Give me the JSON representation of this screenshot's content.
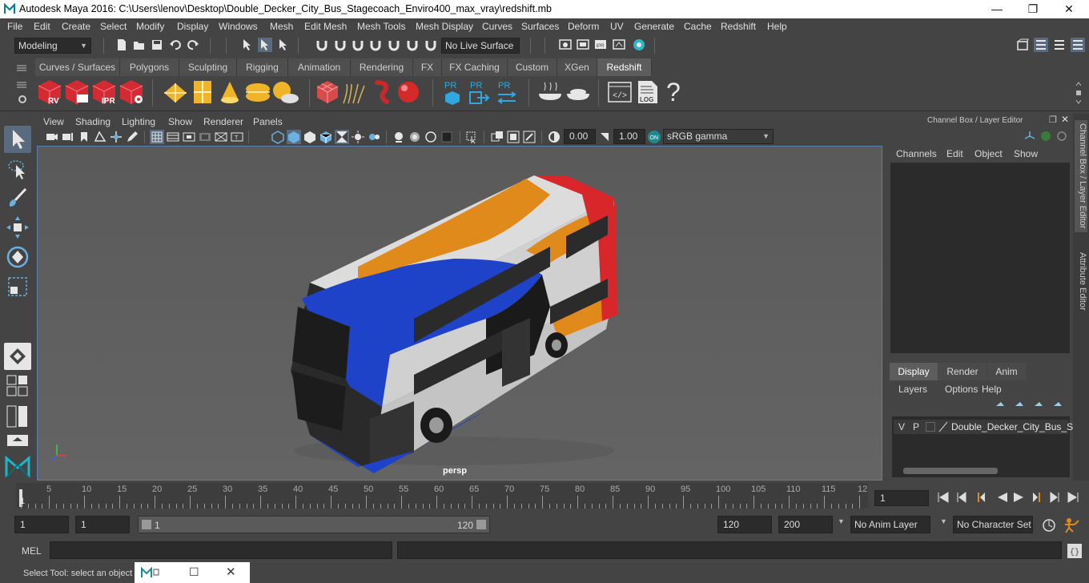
{
  "window": {
    "title": "Autodesk Maya 2016: C:\\Users\\lenov\\Desktop\\Double_Decker_City_Bus_Stagecoach_Enviro400_max_vray\\redshift.mb",
    "minimize": "—",
    "maximize": "❐",
    "close": "✕"
  },
  "menubar": [
    "File",
    "Edit",
    "Create",
    "Select",
    "Modify",
    "Display",
    "Windows",
    "Mesh",
    "Edit Mesh",
    "Mesh Tools",
    "Mesh Display",
    "Curves",
    "Surfaces",
    "Deform",
    "UV",
    "Generate",
    "Cache",
    "Redshift",
    "Help"
  ],
  "statusline": {
    "mode": "Modeling",
    "live_surface": "No Live Surface"
  },
  "shelf_tabs": [
    "Curves / Surfaces",
    "Polygons",
    "Sculpting",
    "Rigging",
    "Animation",
    "Rendering",
    "FX",
    "FX Caching",
    "Custom",
    "XGen",
    "Redshift"
  ],
  "active_shelf_tab": "Redshift",
  "shelf_icons": {
    "rv": "RV",
    "ipr": "IPR",
    "pr": "PR",
    "log": "LOG",
    "help": "?"
  },
  "panel_menu": [
    "View",
    "Shading",
    "Lighting",
    "Show",
    "Renderer",
    "Panels"
  ],
  "panel_toolbar": {
    "exposure": "0.00",
    "gamma": "1.00",
    "color_space": "sRGB gamma"
  },
  "viewport": {
    "camera_label": "persp"
  },
  "channel_box": {
    "title": "Channel Box / Layer Editor",
    "menus": [
      "Channels",
      "Edit",
      "Object",
      "Show"
    ],
    "tabs": [
      "Display",
      "Render",
      "Anim"
    ],
    "active_tab": "Display",
    "layer_menus": [
      "Layers",
      "Options",
      "Help"
    ],
    "layer_row": {
      "v": "V",
      "p": "P",
      "name": "Double_Decker_City_Bus_Sta"
    }
  },
  "side_tabs": [
    "Channel Box / Layer Editor",
    "Attribute Editor"
  ],
  "timeline": {
    "labels": [
      "5",
      "10",
      "15",
      "20",
      "25",
      "30",
      "35",
      "40",
      "45",
      "50",
      "55",
      "60",
      "65",
      "70",
      "75",
      "80",
      "85",
      "90",
      "95",
      "100",
      "105",
      "110",
      "115",
      "12"
    ],
    "current_frame_marker": "1",
    "current_frame": "1"
  },
  "range": {
    "start": "1",
    "playback_start": "1",
    "slider_start": "1",
    "slider_end": "120",
    "playback_end": "120",
    "end": "200",
    "anim_layer": "No Anim Layer",
    "character_set": "No Character Set"
  },
  "command_line": {
    "label": "MEL"
  },
  "help_line": {
    "text": "Select Tool: select an object"
  },
  "colors": {
    "bg": "#444444",
    "accent_blue": "#5a7fb0",
    "bus_red": "#d8262b",
    "bus_orange": "#e08a1c",
    "bus_blue": "#1f43c8"
  }
}
